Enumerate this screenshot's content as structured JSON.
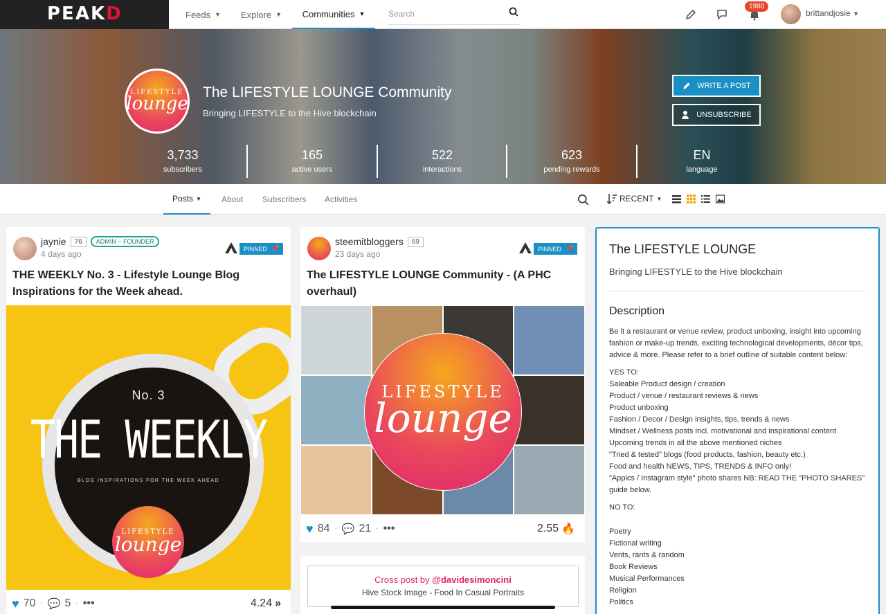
{
  "topnav": {
    "logo_a": "PEAK",
    "logo_b": "D",
    "items": [
      "Feeds",
      "Explore",
      "Communities"
    ],
    "search_placeholder": "Search",
    "notifications": "1980",
    "username": "brittandjosie"
  },
  "banner": {
    "logo_l1": "LIFESTYLE",
    "logo_l2": "lounge",
    "title": "The LIFESTYLE LOUNGE Community",
    "subtitle": "Bringing LIFESTYLE to the Hive blockchain",
    "write_label": "WRITE A POST",
    "unsubscribe_label": "UNSUBSCRIBE",
    "stats": [
      {
        "num": "3,733",
        "label": "subscribers"
      },
      {
        "num": "165",
        "label": "active users"
      },
      {
        "num": "522",
        "label": "interactions"
      },
      {
        "num": "623",
        "label": "pending rewards"
      },
      {
        "num": "EN",
        "label": "language"
      }
    ]
  },
  "subnav": {
    "tabs": [
      "Posts",
      "About",
      "Subscribers",
      "Activities"
    ],
    "sort_label": "RECENT"
  },
  "posts": [
    {
      "author": "jaynie",
      "rep": "76",
      "role": "ADMIN ~ FOUNDER",
      "time": "4 days ago",
      "pinned": "PINNED",
      "title": "THE WEEKLY No. 3 - Lifestyle Lounge Blog Inspirations for the Week ahead.",
      "image_no": "No. 3",
      "image_title": "THE WEEKLY",
      "image_sub": "BLOG INSPIRATIONS FOR THE WEEK AHEAD",
      "likes": "70",
      "comments": "5",
      "payout": "4.24"
    },
    {
      "author": "steemitbloggers",
      "rep": "69",
      "time": "23 days ago",
      "pinned": "PINNED",
      "title": "The LIFESTYLE LOUNGE Community - (A PHC overhaul)",
      "likes": "84",
      "comments": "21",
      "payout": "2.55"
    }
  ],
  "crosspost": {
    "prefix": "Cross post by",
    "user": "@davidesimoncini",
    "title": "Hive Stock Image - Food In Casual Portraits"
  },
  "sidebar": {
    "title": "The LIFESTYLE LOUNGE",
    "subtitle": "Bringing LIFESTYLE to the Hive blockchain",
    "desc_heading": "Description",
    "intro": "Be it a restaurant or venue review, product unboxing, insight into upcoming fashion or make-up trends, exciting technological developments, décor tips, advice & more. Please refer to a brief outline of suitable content below:",
    "yes_heading": "YES TO:",
    "yes_items": [
      "Saleable Product design / creation",
      "Product / venue / restaurant reviews & news",
      "Product unboxing",
      "Fashion / Decor / Design insights, tips, trends & news",
      "Mindset / Wellness posts incl. motivational and inspirational content",
      "Upcoming trends in all the above mentioned niches",
      "\"Tried & tested\" blogs (food products, fashion, beauty etc.)",
      "Food and health NEWS, TIPS, TRENDS & INFO only!",
      "\"Appics / Instagram style\" photo shares NB: READ THE \"PHOTO SHARES\" guide below."
    ],
    "no_heading": "NO TO:",
    "no_items": [
      "Poetry",
      "Fictional writing",
      "Vents, rants & random",
      "Book Reviews",
      "Musical Performances",
      "Religion",
      "Politics"
    ]
  },
  "colors": {
    "accent": "#1a8fc4",
    "brand_red": "#e31337",
    "lounge_pink": "#e1246d"
  }
}
